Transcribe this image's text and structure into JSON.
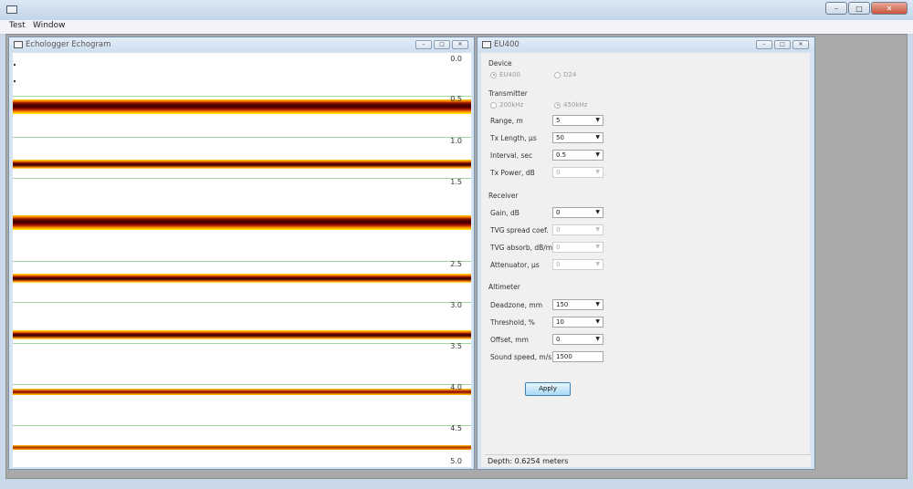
{
  "menubar": {
    "items": [
      "Test",
      "Window"
    ]
  },
  "main_window": {
    "controls": {
      "minimize": "–",
      "maximize": "□",
      "close": "✕"
    }
  },
  "echogram": {
    "title": "Echologger Echogram",
    "depth_labels": [
      "0.0",
      "0.5",
      "1.0",
      "1.5",
      "2.5",
      "3.0",
      "3.5",
      "4.0",
      "4.5",
      "5.0"
    ],
    "controls": {
      "minimize": "–",
      "maximize": "□",
      "close": "✕"
    }
  },
  "eu400": {
    "title": "EU400",
    "controls": {
      "minimize": "–",
      "maximize": "□",
      "close": "✕"
    },
    "device": {
      "label": "Device",
      "options": [
        {
          "label": "EU400",
          "selected": true
        },
        {
          "label": "D24",
          "selected": false
        }
      ]
    },
    "transmitter": {
      "label": "Transmitter",
      "options": [
        {
          "label": "200kHz",
          "selected": false
        },
        {
          "label": "450kHz",
          "selected": true
        }
      ],
      "range": {
        "label": "Range, m",
        "value": "5"
      },
      "tx_length": {
        "label": "Tx Length, µs",
        "value": "50"
      },
      "interval": {
        "label": "Interval, sec",
        "value": "0.5"
      },
      "tx_power": {
        "label": "Tx Power, dB",
        "value": "0"
      }
    },
    "receiver": {
      "label": "Receiver",
      "gain": {
        "label": "Gain, dB",
        "value": "0"
      },
      "tvg_spread": {
        "label": "TVG spread coef.",
        "value": "0"
      },
      "tvg_absorb": {
        "label": "TVG absorb, dB/m",
        "value": "0"
      },
      "attenuator": {
        "label": "Attenuator, µs",
        "value": "0"
      }
    },
    "altimeter": {
      "label": "Altimeter",
      "deadzone": {
        "label": "Deadzone, mm",
        "value": "150"
      },
      "threshold": {
        "label": "Threshold, %",
        "value": "10"
      },
      "offset": {
        "label": "Offset, mm",
        "value": "0"
      },
      "sound_speed": {
        "label": "Sound speed, m/s",
        "value": "1500"
      }
    },
    "apply_label": "Apply",
    "status": "Depth: 0.6254 meters"
  },
  "colors": {
    "accent": "#3c7fb1",
    "echo_dark": "#3a0000",
    "echo_yellow": "#fff200",
    "grid": "#9fd69f"
  }
}
